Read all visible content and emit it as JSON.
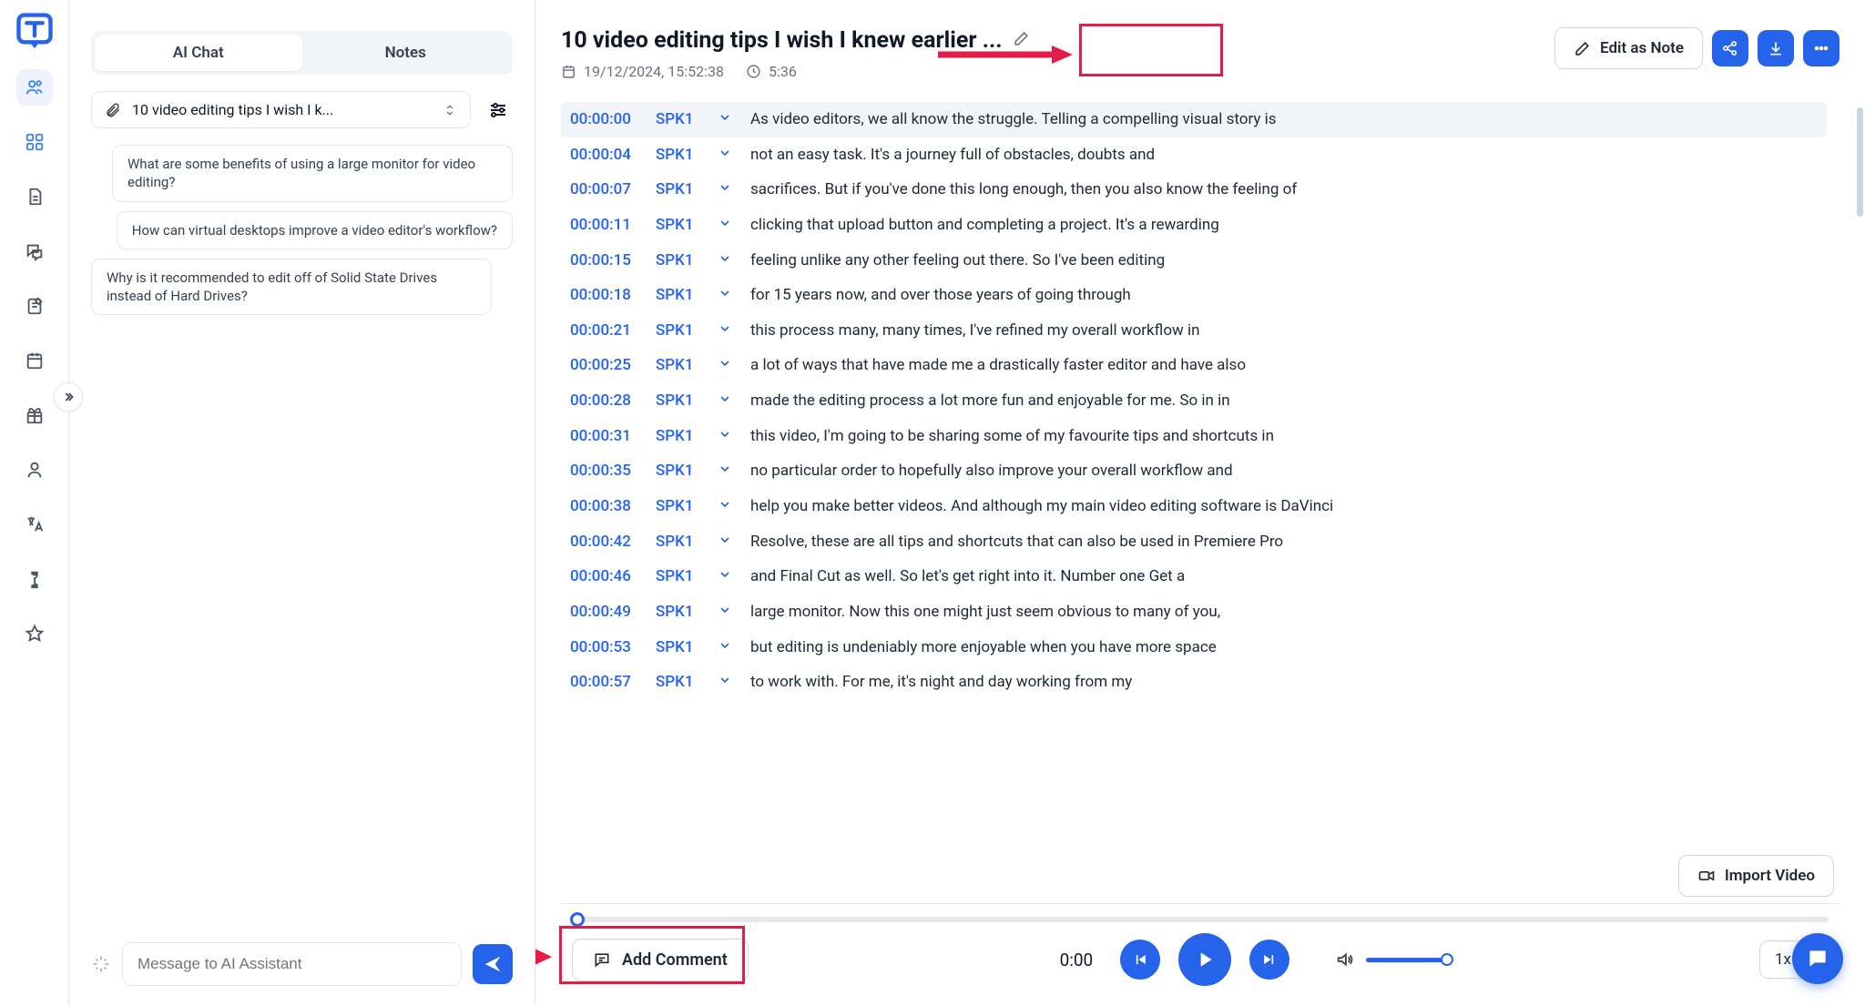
{
  "tabs": {
    "chat": "AI Chat",
    "notes": "Notes"
  },
  "file_select": "10 video editing tips I wish I k...",
  "suggestions": [
    "What are some benefits of using a large monitor for video editing?",
    "How can virtual desktops improve a video editor's workflow?",
    "Why is it recommended to edit off of Solid State Drives instead of Hard Drives?"
  ],
  "chat_placeholder": "Message to AI Assistant",
  "title": "10 video editing tips I wish I knew earlier ...",
  "meta": {
    "date": "19/12/2024, 15:52:38",
    "duration": "5:36"
  },
  "edit_note_label": "Edit as Note",
  "import_video_label": "Import Video",
  "add_comment_label": "Add Comment",
  "player": {
    "position": "0:00",
    "speed": "1x"
  },
  "transcript": [
    {
      "t": "00:00:00",
      "s": "SPK1",
      "x": "As video editors, we all know the struggle. Telling a compelling visual story is"
    },
    {
      "t": "00:00:04",
      "s": "SPK1",
      "x": "not an easy task. It's a journey full of obstacles, doubts and"
    },
    {
      "t": "00:00:07",
      "s": "SPK1",
      "x": "sacrifices. But if you've done this long enough, then you also know the feeling of"
    },
    {
      "t": "00:00:11",
      "s": "SPK1",
      "x": "clicking that upload button and completing a project. It's a rewarding"
    },
    {
      "t": "00:00:15",
      "s": "SPK1",
      "x": "feeling unlike any other feeling out there. So I've been editing"
    },
    {
      "t": "00:00:18",
      "s": "SPK1",
      "x": "for 15 years now, and over those years of going through"
    },
    {
      "t": "00:00:21",
      "s": "SPK1",
      "x": "this process many, many times, I've refined my overall workflow in"
    },
    {
      "t": "00:00:25",
      "s": "SPK1",
      "x": "a lot of ways that have made me a drastically faster editor and have also"
    },
    {
      "t": "00:00:28",
      "s": "SPK1",
      "x": "made the editing process a lot more fun and enjoyable for me. So in in"
    },
    {
      "t": "00:00:31",
      "s": "SPK1",
      "x": "this video, I'm going to be sharing some of my favourite tips and shortcuts in"
    },
    {
      "t": "00:00:35",
      "s": "SPK1",
      "x": "no particular order to hopefully also improve your overall workflow and"
    },
    {
      "t": "00:00:38",
      "s": "SPK1",
      "x": "help you make better videos. And although my main video editing software is DaVinci"
    },
    {
      "t": "00:00:42",
      "s": "SPK1",
      "x": "Resolve, these are all tips and shortcuts that can also be used in Premiere Pro"
    },
    {
      "t": "00:00:46",
      "s": "SPK1",
      "x": "and Final Cut as well. So let's get right into it. Number one Get a"
    },
    {
      "t": "00:00:49",
      "s": "SPK1",
      "x": "large monitor. Now this one might just seem obvious to many of you,"
    },
    {
      "t": "00:00:53",
      "s": "SPK1",
      "x": "but editing is undeniably more enjoyable when you have more space"
    },
    {
      "t": "00:00:57",
      "s": "SPK1",
      "x": "to work with. For me, it's night and day working from my"
    }
  ]
}
